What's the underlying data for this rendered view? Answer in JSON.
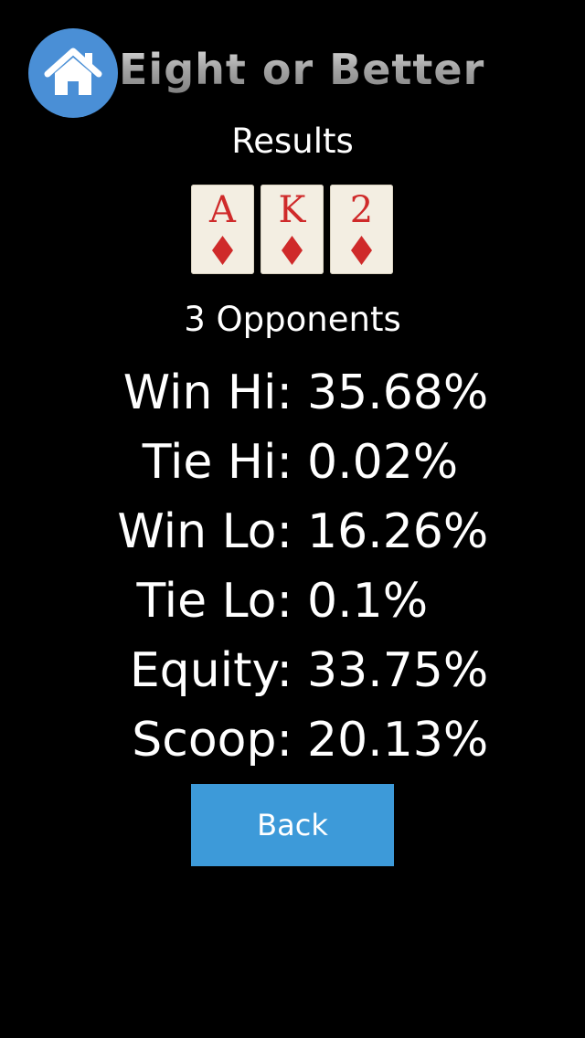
{
  "header": {
    "title": "Eight or Better",
    "home_icon": "home-icon"
  },
  "results": {
    "subtitle": "Results",
    "cards": [
      {
        "rank": "A",
        "suit": "diamonds"
      },
      {
        "rank": "K",
        "suit": "diamonds"
      },
      {
        "rank": "2",
        "suit": "diamonds"
      }
    ],
    "opponents_label": "3 Opponents",
    "stats": [
      {
        "label": "Win Hi:",
        "value": "35.68%"
      },
      {
        "label": "Tie Hi:",
        "value": "0.02%"
      },
      {
        "label": "Win Lo:",
        "value": "16.26%"
      },
      {
        "label": "Tie Lo:",
        "value": "0.1%"
      },
      {
        "label": "Equity:",
        "value": "33.75%"
      },
      {
        "label": "Scoop:",
        "value": "20.13%"
      }
    ]
  },
  "actions": {
    "back_label": "Back"
  },
  "colors": {
    "background": "#000000",
    "home_button": "#4a8fd6",
    "back_button": "#3d9ad9",
    "card_face": "#f3eee2",
    "card_red": "#cf2a2a"
  }
}
